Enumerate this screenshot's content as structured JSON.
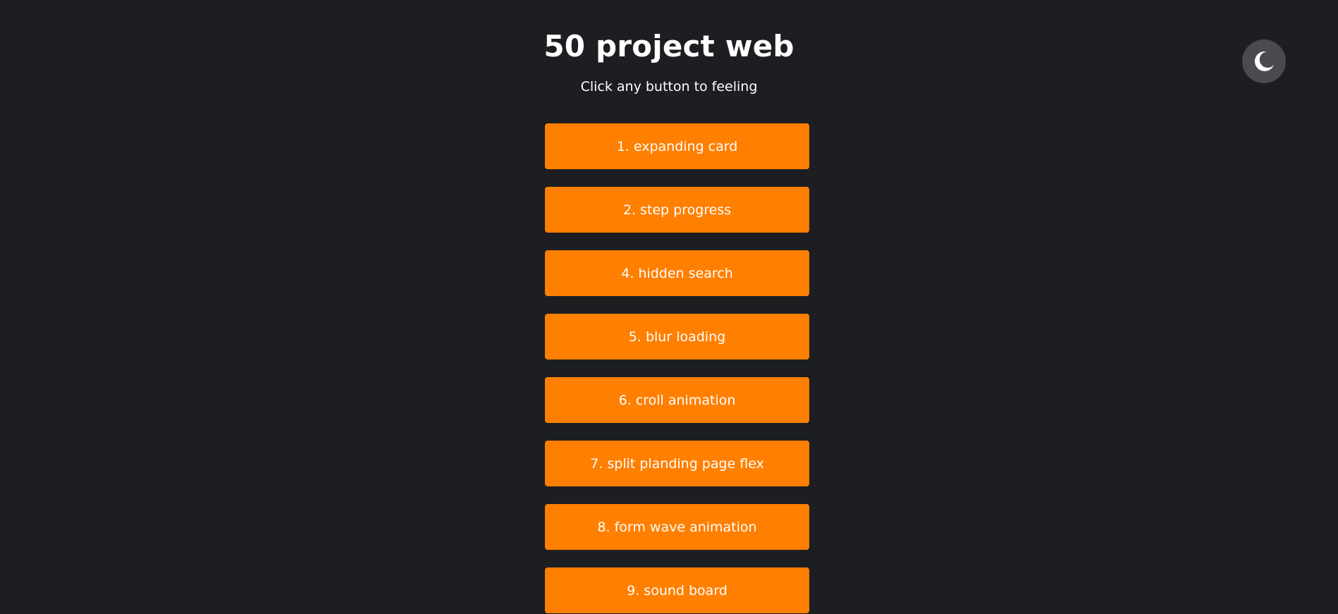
{
  "header": {
    "title": "50 project web",
    "subtitle": "Click any button to feeling"
  },
  "theme_toggle": {
    "icon": "moon-icon"
  },
  "colors": {
    "background": "#1d1e22",
    "accent": "#ff7f00",
    "toggle_background": "#4a4b50",
    "text": "#ffffff"
  },
  "projects": [
    {
      "label": "1. expanding card"
    },
    {
      "label": "2. step progress"
    },
    {
      "label": "4. hidden search"
    },
    {
      "label": "5. blur loading"
    },
    {
      "label": "6. croll animation"
    },
    {
      "label": "7. split planding page flex"
    },
    {
      "label": "8. form wave animation"
    },
    {
      "label": "9. sound board"
    }
  ]
}
